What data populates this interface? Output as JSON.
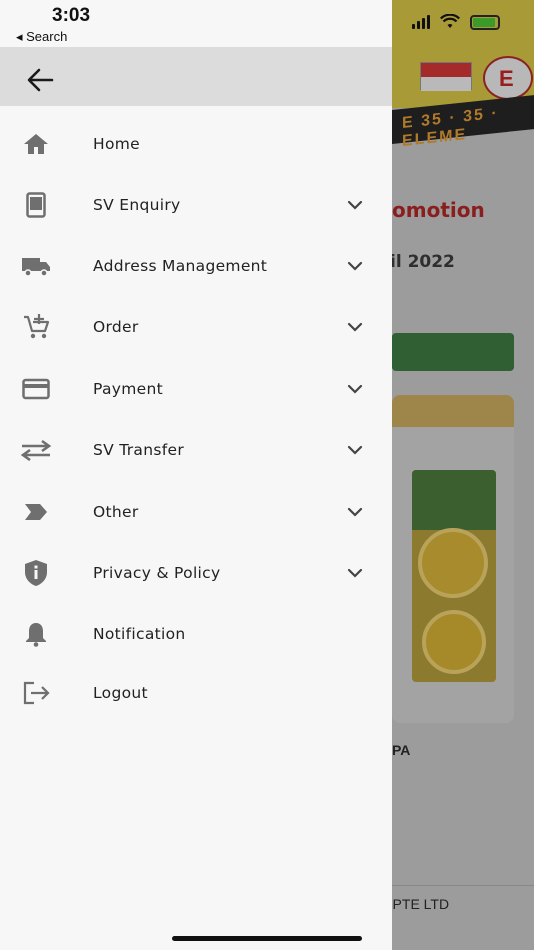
{
  "status_bar": {
    "time": "3:03",
    "back_label": "◂ Search"
  },
  "drawer": {
    "back_icon": "arrow-left-icon",
    "items": [
      {
        "label": "Home",
        "icon": "home-icon",
        "expandable": false
      },
      {
        "label": "SV Enquiry",
        "icon": "tablet-icon",
        "expandable": true
      },
      {
        "label": "Address Management",
        "icon": "truck-icon",
        "expandable": true
      },
      {
        "label": "Order",
        "icon": "cart-add-icon",
        "expandable": true
      },
      {
        "label": "Payment",
        "icon": "credit-card-icon",
        "expandable": true
      },
      {
        "label": "SV Transfer",
        "icon": "swap-arrows-icon",
        "expandable": true
      },
      {
        "label": "Other",
        "icon": "label-tag-icon",
        "expandable": true
      },
      {
        "label": "Privacy & Policy",
        "icon": "shield-info-icon",
        "expandable": true
      },
      {
        "label": "Notification",
        "icon": "bell-icon",
        "expandable": false
      },
      {
        "label": "Logout",
        "icon": "logout-icon",
        "expandable": false
      }
    ]
  },
  "background": {
    "banner_text": "E 35 · 35 · ELEME",
    "promo_text": "omotion",
    "date_text": "il 2022",
    "product_name": "PA",
    "footer_text": ") PTE LTD"
  },
  "colors": {
    "drawer_bg": "#f7f7f7",
    "header_bg": "#dcdcdc",
    "icon": "#6f6f6f",
    "text": "#222222"
  }
}
